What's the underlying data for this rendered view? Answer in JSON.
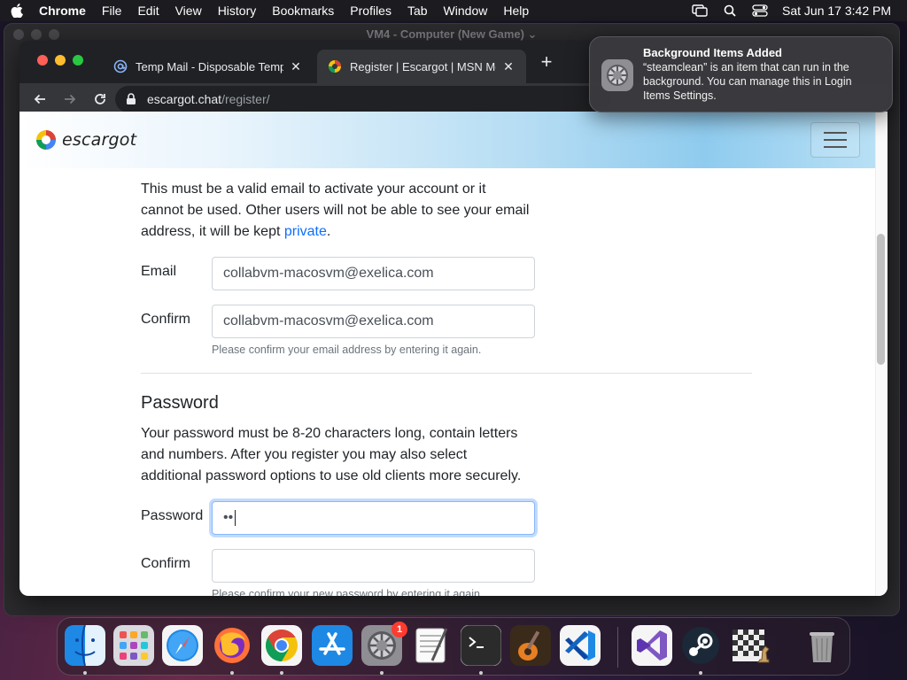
{
  "menubar": {
    "app": "Chrome",
    "items": [
      "File",
      "Edit",
      "View",
      "History",
      "Bookmarks",
      "Profiles",
      "Tab",
      "Window",
      "Help"
    ],
    "clock": "Sat Jun 17  3:42 PM"
  },
  "vm_window": {
    "title": "VM4 - Computer   (New Game) ⌄"
  },
  "browser": {
    "tabs": [
      {
        "title": "Temp Mail - Disposable Tempor",
        "icon": "at-sign-icon"
      },
      {
        "title": "Register | Escargot | MSN Mess",
        "icon": "escargot-icon"
      }
    ],
    "url_host": "escargot.chat",
    "url_path": "/register/"
  },
  "site": {
    "logo_text": "escargot"
  },
  "form": {
    "email_intro": "This must be a valid email to activate your account or it cannot be used. Other users will not be able to see your email address, it will be kept ",
    "email_intro_link": "private",
    "email_intro_end": ".",
    "email_label": "Email",
    "email_value": "collabvm-macosvm@exelica.com",
    "confirm_label": "Confirm",
    "confirm_email_value": "collabvm-macosvm@exelica.com",
    "confirm_email_help": "Please confirm your email address by entering it again.",
    "password_title": "Password",
    "password_intro": "Your password must be 8-20 characters long, contain letters and numbers. After you register you may also select additional password options to use old clients more securely.",
    "password_label": "Password",
    "password_value": "••",
    "confirm_password_label": "Confirm",
    "confirm_password_help": "Please confirm your new password by entering it again."
  },
  "notification": {
    "title": "Background Items Added",
    "body": "“steamclean” is an item that can run in the background. You can manage this in Login Items Settings.",
    "icon": "gear-icon"
  },
  "dock": {
    "apps": [
      "finder-icon",
      "launchpad-icon",
      "safari-icon",
      "firefox-icon",
      "chrome-icon",
      "app-store-icon",
      "system-settings-icon",
      "textedit-icon",
      "terminal-icon",
      "garageband-icon",
      "vscode-icon",
      "visual-studio-icon",
      "steam-icon",
      "chess-icon",
      "trash-icon"
    ],
    "settings_badge": "1"
  }
}
